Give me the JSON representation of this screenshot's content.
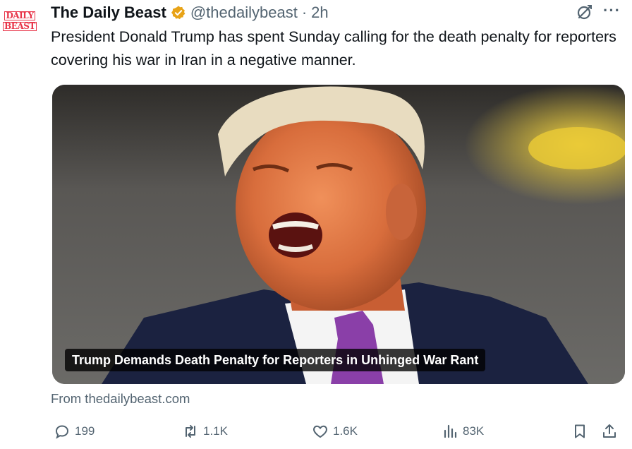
{
  "author": {
    "avatar_text_top": "DAILY",
    "avatar_text_bottom": "BEAST",
    "name": "The Daily Beast",
    "handle": "@thedailybeast",
    "separator": "·",
    "time": "2h",
    "verified_color": "#e8a317"
  },
  "tweet": {
    "text": "President Donald Trump has spent Sunday calling for the death penalty for reporters covering his war in Iran in a negative manner."
  },
  "card": {
    "headline": "Trump Demands Death Penalty for Reporters in Unhinged War Rant",
    "source": "From thedailybeast.com"
  },
  "actions": {
    "replies": "199",
    "retweets": "1.1K",
    "likes": "1.6K",
    "views": "83K"
  },
  "colors": {
    "brand_red": "#e8364a",
    "muted": "#536471",
    "text": "#0f1419"
  }
}
